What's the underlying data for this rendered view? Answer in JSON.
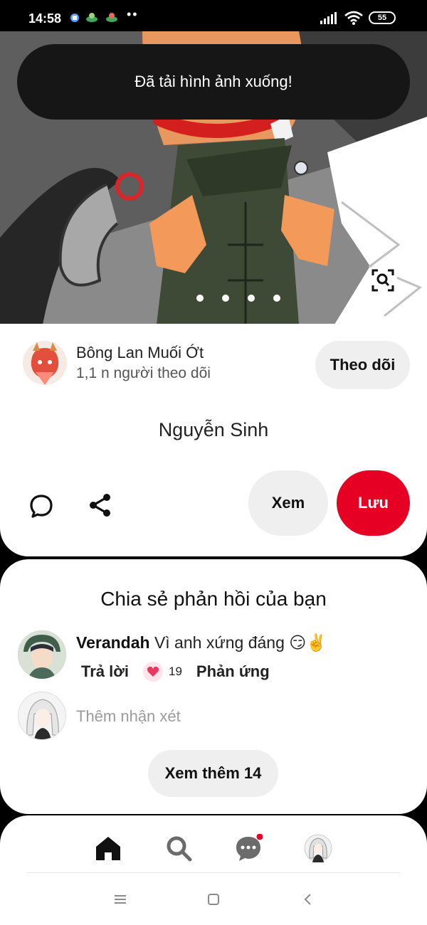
{
  "status_bar": {
    "time": "14:58",
    "dots": "••",
    "battery": "55"
  },
  "hero": {
    "toast": "Đã tải hình ảnh xuống!",
    "page_count": 4,
    "lens_icon": "visual-search-icon"
  },
  "creator": {
    "name": "Bông Lan Muối Ớt",
    "followers": "1,1 n người theo dõi",
    "follow_label": "Theo dõi"
  },
  "pin": {
    "title": "Nguyễn Sinh",
    "view_label": "Xem",
    "save_label": "Lưu",
    "save_color": "#e60023"
  },
  "comments": {
    "heading": "Chia sẻ phản hồi của bạn",
    "items": [
      {
        "author": "Verandah",
        "text": "Vì anh xứng đáng 😏✌️",
        "reply_label": "Trả lời",
        "reaction_count": "19",
        "react_label": "Phản ứng"
      }
    ],
    "add_placeholder": "Thêm nhận xét",
    "see_more_label": "Xem thêm 14"
  },
  "bottom_nav": {
    "tabs": [
      "home-icon",
      "search-icon",
      "messages-icon",
      "profile-avatar"
    ],
    "active": "home-icon",
    "messages_badge_color": "#e60023"
  },
  "system_nav": [
    "recents-icon",
    "home-square-icon",
    "back-icon"
  ]
}
